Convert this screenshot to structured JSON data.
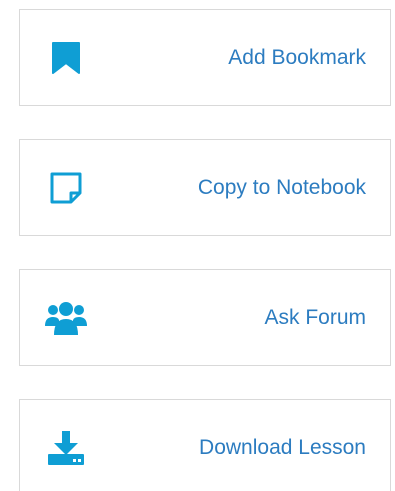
{
  "actions": {
    "accent_color": "#2c7cc0",
    "icon_color": "#0f9ed4",
    "items": [
      {
        "label": "Add Bookmark",
        "icon": "bookmark-icon"
      },
      {
        "label": "Copy to Notebook",
        "icon": "sticky-note-icon"
      },
      {
        "label": "Ask Forum",
        "icon": "users-icon"
      },
      {
        "label": "Download Lesson",
        "icon": "download-icon"
      }
    ]
  }
}
